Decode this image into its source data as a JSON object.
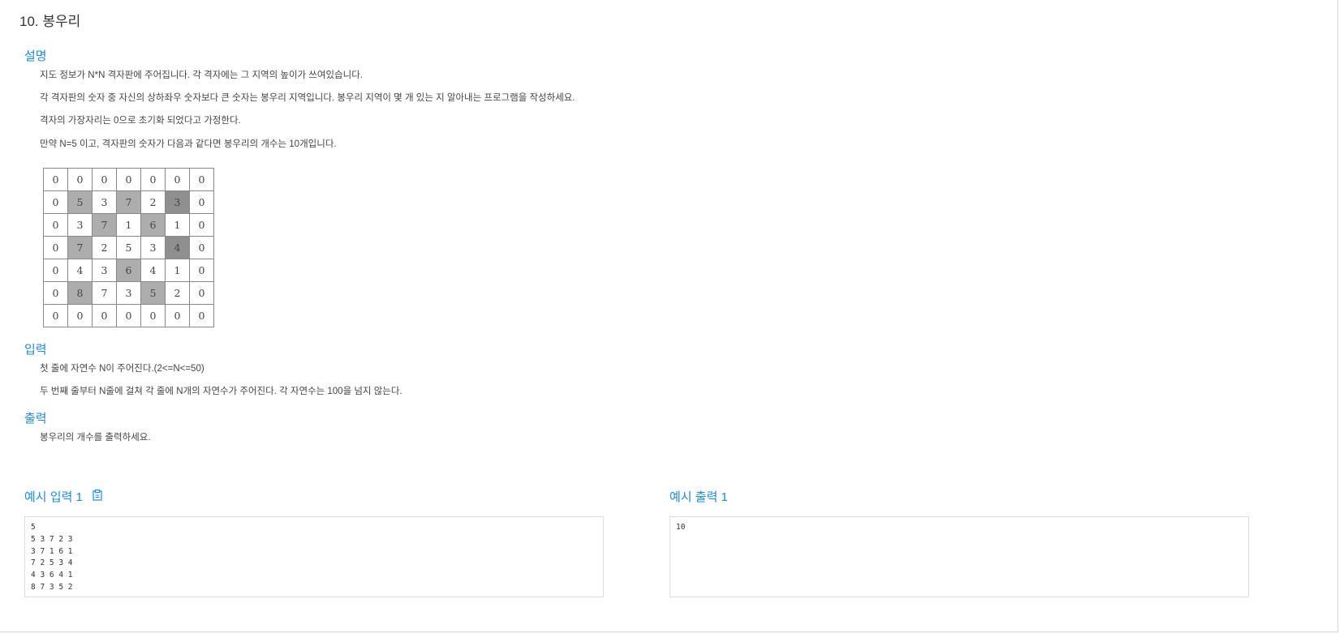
{
  "problem": {
    "title": "10. 봉우리"
  },
  "description": {
    "heading": "설명",
    "paragraphs": [
      "지도 정보가 N*N 격자판에 주어집니다. 각 격자에는 그 지역의 높이가 쓰여있습니다.",
      "각 격자판의 숫자 중 자신의 상하좌우 숫자보다 큰 숫자는 봉우리 지역입니다. 봉우리 지역이 몇 개 있는 지 알아내는 프로그램을 작성하세요.",
      "격자의 가장자리는 0으로 초기화 되었다고 가정한다.",
      "만약 N=5 이고, 격자판의 숫자가 다음과 같다면 봉우리의 개수는 10개입니다."
    ],
    "grid": [
      [
        "0",
        "0",
        "0",
        "0",
        "0",
        "0",
        "0"
      ],
      [
        "0",
        "5",
        "3",
        "7",
        "2",
        "3",
        "0"
      ],
      [
        "0",
        "3",
        "7",
        "1",
        "6",
        "1",
        "0"
      ],
      [
        "0",
        "7",
        "2",
        "5",
        "3",
        "4",
        "0"
      ],
      [
        "0",
        "4",
        "3",
        "6",
        "4",
        "1",
        "0"
      ],
      [
        "0",
        "8",
        "7",
        "3",
        "5",
        "2",
        "0"
      ],
      [
        "0",
        "0",
        "0",
        "0",
        "0",
        "0",
        "0"
      ]
    ],
    "peaks_light": [
      [
        1,
        1
      ],
      [
        1,
        3
      ],
      [
        2,
        2
      ],
      [
        2,
        4
      ],
      [
        3,
        1
      ],
      [
        4,
        3
      ],
      [
        5,
        1
      ],
      [
        5,
        4
      ]
    ],
    "peaks_dark": [
      [
        1,
        5
      ],
      [
        3,
        5
      ]
    ],
    "colors": {
      "light": "#adadad",
      "dark": "#8f8f8f"
    }
  },
  "input": {
    "heading": "입력",
    "paragraphs": [
      "첫 줄에 자연수 N이 주어진다.(2<=N<=50)",
      "두 번째 줄부터 N줄에 걸쳐 각 줄에 N개의 자연수가 주어진다. 각 자연수는 100을 넘지 않는다."
    ]
  },
  "output": {
    "heading": "출력",
    "paragraphs": [
      "봉우리의 개수를 출력하세요."
    ]
  },
  "example_input": {
    "heading": "예시 입력 1",
    "copy_icon": "clipboard-icon",
    "content": "5\n5 3 7 2 3\n3 7 1 6 1\n7 2 5 3 4\n4 3 6 4 1\n8 7 3 5 2"
  },
  "example_output": {
    "heading": "예시 출력 1",
    "content": "10"
  },
  "accent_color": "#1e88e5"
}
